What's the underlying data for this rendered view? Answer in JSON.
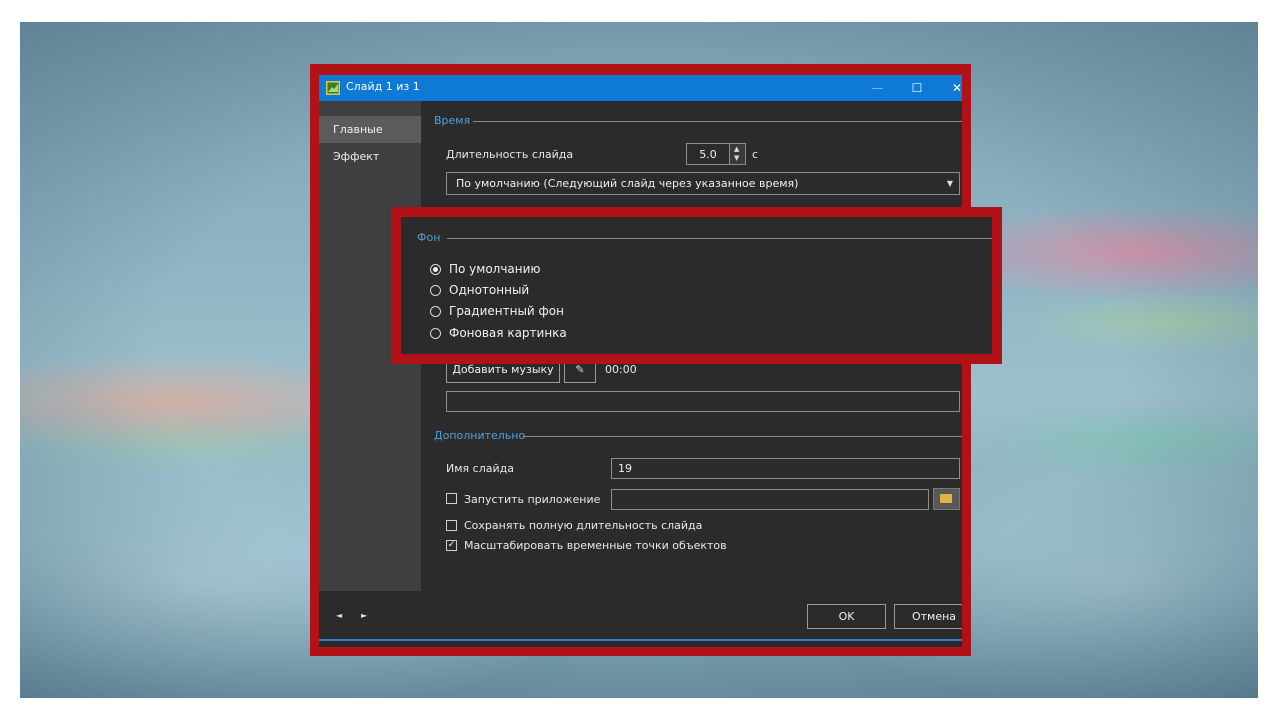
{
  "window": {
    "title": "Слайд 1 из 1",
    "controls": {
      "minimize": "—",
      "maximize": "☐",
      "close": "✕"
    }
  },
  "sidebar": {
    "items": [
      {
        "label": "Главные",
        "active": true
      },
      {
        "label": "Эффект",
        "active": false
      }
    ]
  },
  "time_section": {
    "heading": "Время",
    "duration_label": "Длительность слайда",
    "duration_value": "5.0",
    "duration_unit": "с",
    "transition_select": "По умолчанию (Следующий слайд через указанное время)"
  },
  "background_section": {
    "heading": "Фон",
    "options": [
      {
        "label": "По умолчанию",
        "selected": true
      },
      {
        "label": "Однотонный",
        "selected": false
      },
      {
        "label": "Градиентный фон",
        "selected": false
      },
      {
        "label": "Фоновая картинка",
        "selected": false
      }
    ]
  },
  "music": {
    "add_button": "Добавить музыку",
    "tool_icon": "wrench-icon",
    "time": "00:00",
    "file_value": ""
  },
  "extra_section": {
    "heading": "Дополнительно",
    "slide_name_label": "Имя слайда",
    "slide_name_value": "19",
    "run_app_label": "Запустить приложение",
    "run_app_checked": false,
    "run_app_value": "",
    "keep_duration_label": "Сохранять полную длительность слайда",
    "keep_duration_checked": false,
    "scale_points_label": "Масштабировать временные точки объектов",
    "scale_points_checked": true
  },
  "footer": {
    "prev_icon": "◄",
    "next_icon": "►",
    "ok_label": "OK",
    "cancel_label": "Отмена"
  },
  "colors": {
    "titlebar": "#0f79d6",
    "highlight_frame": "#b01218",
    "section_heading": "#4ea0dc",
    "dialog_bg": "#2b2b2b"
  }
}
